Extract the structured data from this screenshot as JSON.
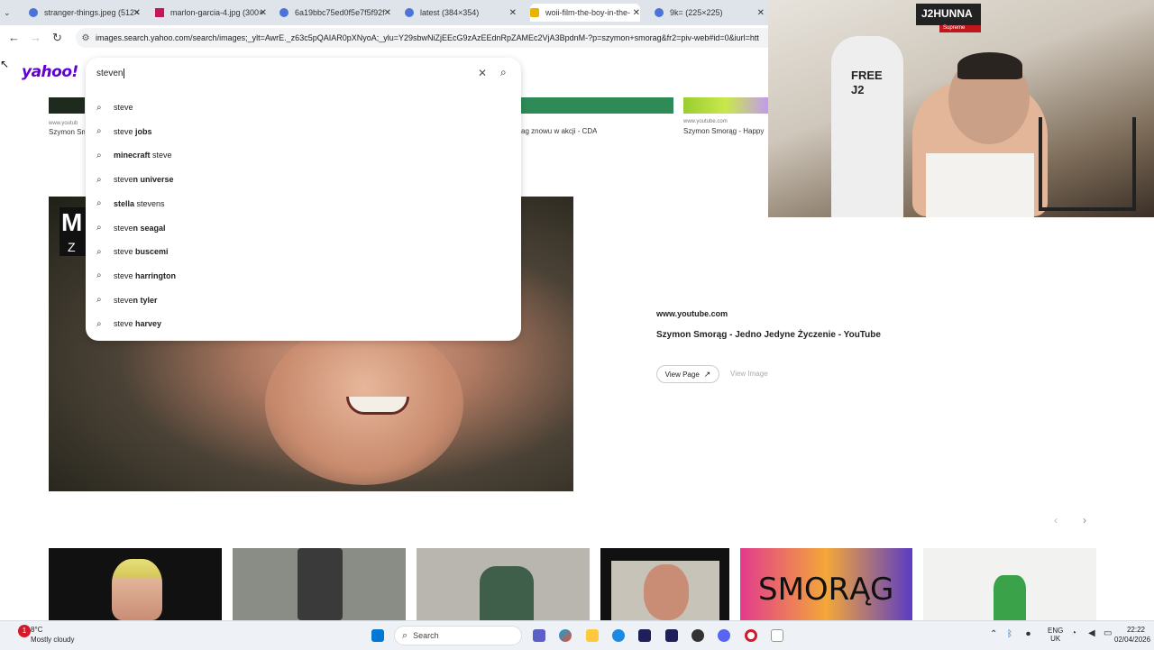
{
  "browser": {
    "tabs": [
      {
        "title": "stranger-things.jpeg (512×",
        "favicon_color": "#4a74d9"
      },
      {
        "title": "marlon-garcia-4.jpg (300×",
        "favicon_color": "#c2185b"
      },
      {
        "title": "6a19bbc75ed0f5e7f5f92f",
        "favicon_color": "#4a74d9"
      },
      {
        "title": "latest (384×354)",
        "favicon_color": "#4a74d9"
      },
      {
        "title": "woii-film-the-boy-in-the-",
        "favicon_color": "#e8b400"
      },
      {
        "title": "9k= (225×225)",
        "favicon_color": "#4a74d9"
      }
    ],
    "url": "images.search.yahoo.com/search/images;_ylt=AwrE._z63c5pQAIAR0pXNyoA;_ylu=Y29sbwNiZjEEcG9zAzEEdnRpZAMEc2VjA3BpdnM-?p=szymon+smorag&fr2=piv-web#id=0&iurl=htt"
  },
  "yahoo": {
    "logo": "yahoo!"
  },
  "search": {
    "query": "steven",
    "suggestions": [
      {
        "prefix": "steve",
        "rest": ""
      },
      {
        "prefix": "steve",
        "rest": " jobs"
      },
      {
        "prefix": "",
        "rest": "minecraft",
        "suffix": " steve"
      },
      {
        "prefix": "steve",
        "rest": "n universe"
      },
      {
        "prefix": "",
        "rest": "stella",
        "suffix": " stevens"
      },
      {
        "prefix": "steve",
        "rest": "n seagal"
      },
      {
        "prefix": "steve",
        "rest": " buscemi"
      },
      {
        "prefix": "steve",
        "rest": " harrington"
      },
      {
        "prefix": "steve",
        "rest": "n tyler"
      },
      {
        "prefix": "steve",
        "rest": " harvey"
      }
    ]
  },
  "top_row": {
    "left_domain": "www.youtub",
    "left_caption": "Szymon Sm",
    "mid_caption": "ag znowu w akcji - CDA",
    "right_domain": "www.youtube.com",
    "right_caption": "Szymon Smorąg - Happy"
  },
  "detail": {
    "source": "www.youtube.com",
    "title": "Szymon Smorąg - Jedno Jedyne Życzenie - YouTube",
    "view_page": "View Page",
    "view_image": "View Image",
    "overlay_letters": [
      "M",
      "Z"
    ]
  },
  "strip_labels": [
    "SMORĄG"
  ],
  "webcam": {
    "shirt_text": "FREE J2",
    "poster_text": "J2HUNNA",
    "sticker_text": "Supreme"
  },
  "taskbar": {
    "weather_temp": "8°C",
    "weather_desc": "Mostly cloudy",
    "weather_badge": "1",
    "search_label": "Search",
    "lang": "ENG",
    "region": "UK",
    "time": "22:22",
    "date": "02/04/2026",
    "colors": {
      "windows": "#0078d4",
      "opera": "#d11a2a"
    }
  }
}
